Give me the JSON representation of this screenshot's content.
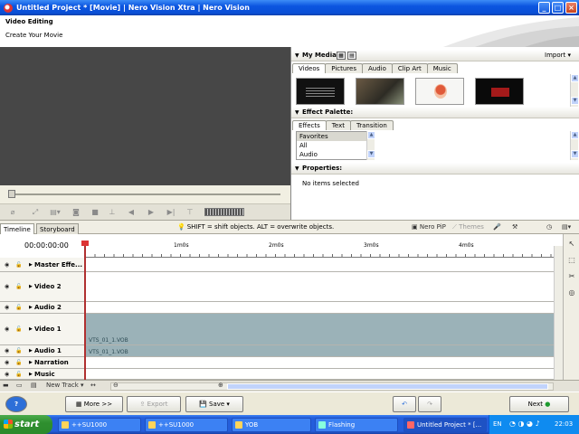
{
  "window": {
    "title": "Untitled Project * [Movie] | Nero Vision Xtra | Nero Vision",
    "controls": [
      "_",
      "□",
      "×"
    ]
  },
  "header": {
    "title": "Video Editing",
    "subtitle": "Create Your Movie"
  },
  "my_media": {
    "title": "My Media",
    "import_label": "Import",
    "tabs": [
      "Videos",
      "Pictures",
      "Audio",
      "Clip Art",
      "Music"
    ],
    "active_tab": "Videos"
  },
  "effect_palette": {
    "title": "Effect Palette:",
    "tabs": [
      "Effects",
      "Text",
      "Transition"
    ],
    "active_tab": "Effects",
    "items": [
      "Favorites",
      "All",
      "Audio"
    ],
    "selected": "Favorites"
  },
  "properties": {
    "title": "Properties:",
    "empty_text": "No items selected"
  },
  "timeline": {
    "tabs": [
      "Timeline",
      "Storyboard"
    ],
    "active_tab": "Timeline",
    "hint": "SHIFT = shift objects. ALT = overwrite objects.",
    "nero_pip": "Nero PiP",
    "themes": "Themes",
    "timecode": "00:00:00:00",
    "ticks": [
      "1m0s",
      "2m0s",
      "3m0s",
      "4m0s"
    ],
    "tracks": [
      {
        "name": "Master Effe...",
        "clip": ""
      },
      {
        "name": "Video 2",
        "clip": ""
      },
      {
        "name": "Audio 2",
        "clip": ""
      },
      {
        "name": "Video 1",
        "clip": "VTS_01_1.VOB"
      },
      {
        "name": "Audio 1",
        "clip": "VTS_01_1.VOB"
      },
      {
        "name": "Narration",
        "clip": ""
      },
      {
        "name": "Music",
        "clip": ""
      }
    ],
    "new_track_label": "New Track"
  },
  "actions": {
    "help": "?",
    "more": "More >>",
    "export": "Export",
    "save": "Save",
    "next": "Next"
  },
  "taskbar": {
    "start": "start",
    "tasks": [
      "++SU1000",
      "++SU1000",
      "YOB",
      "Flashing",
      "Untitled Project * [..."
    ],
    "lang": "EN",
    "clock": "22:03"
  }
}
